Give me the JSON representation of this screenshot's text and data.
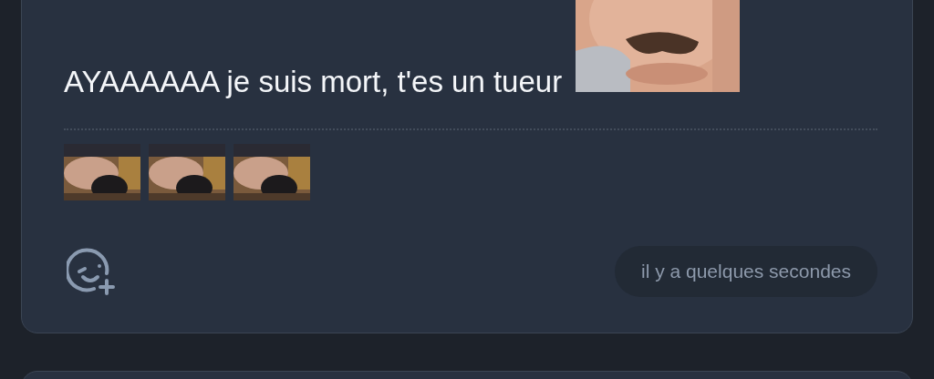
{
  "post": {
    "message": "AYAAAAAA je suis mort, t'es un tueur",
    "timestamp": "il y a quelques secondes"
  }
}
